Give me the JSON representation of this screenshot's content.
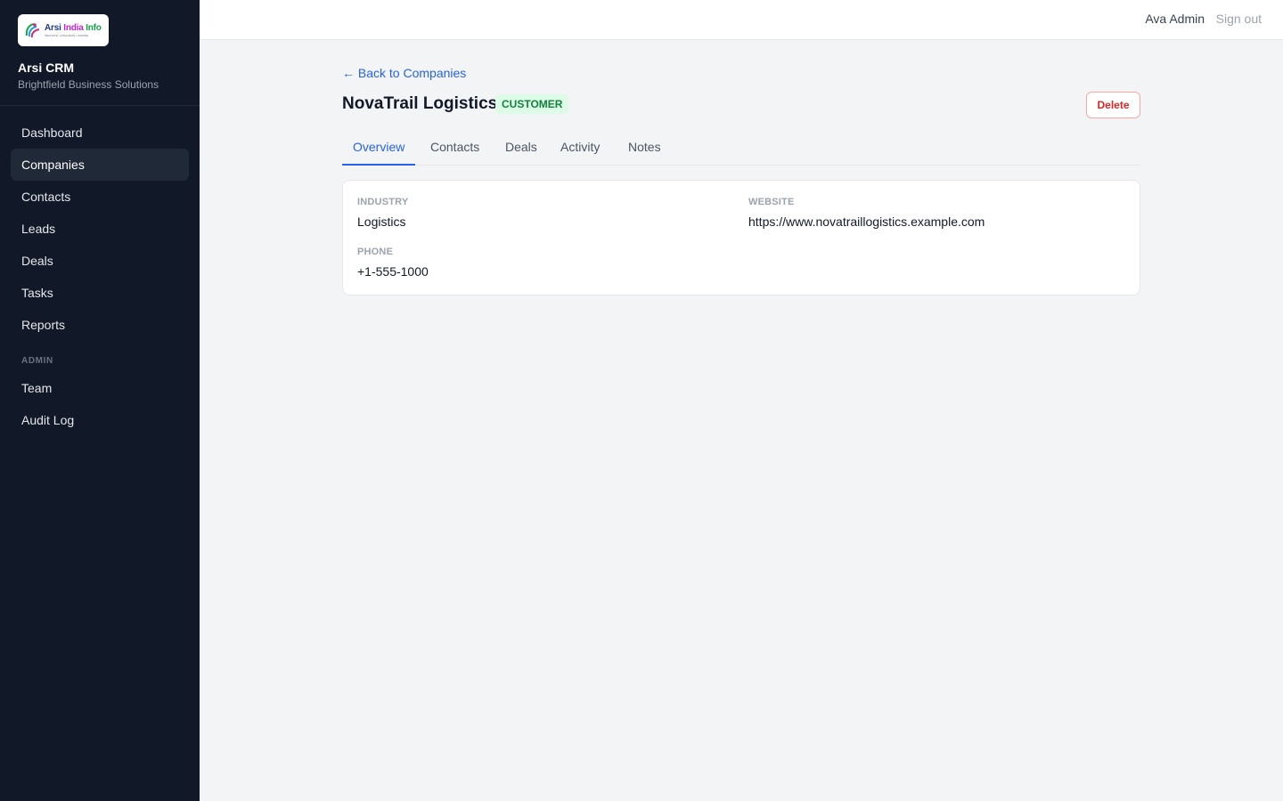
{
  "brand": {
    "logo_word_1": "Arsi",
    "logo_word_2": "India",
    "logo_word_3": "Info",
    "logo_tagline": "INNOVATE • INTEGRATE • INSPIRE",
    "app_name": "Arsi CRM",
    "org_name": "Brightfield Business Solutions"
  },
  "sidebar": {
    "items": [
      {
        "label": "Dashboard"
      },
      {
        "label": "Companies",
        "active": true
      },
      {
        "label": "Contacts"
      },
      {
        "label": "Leads"
      },
      {
        "label": "Deals"
      },
      {
        "label": "Tasks"
      },
      {
        "label": "Reports"
      }
    ],
    "admin_section_label": "ADMIN",
    "admin_items": [
      {
        "label": "Team"
      },
      {
        "label": "Audit Log"
      }
    ]
  },
  "topbar": {
    "user_name": "Ava Admin",
    "signout_label": "Sign out"
  },
  "page": {
    "back_link": "← Back to Companies",
    "title": "NovaTrail Logistics",
    "status_badge": "CUSTOMER",
    "delete_label": "Delete"
  },
  "tabs": [
    {
      "label": "Overview",
      "active": true
    },
    {
      "label": "Contacts"
    },
    {
      "label": "Deals"
    },
    {
      "label": "Activity"
    },
    {
      "label": "Notes"
    }
  ],
  "overview": {
    "industry_label": "INDUSTRY",
    "industry_value": "Logistics",
    "website_label": "WEBSITE",
    "website_value": "https://www.novatraillogistics.example.com",
    "phone_label": "PHONE",
    "phone_value": "+1-555-1000"
  },
  "colors": {
    "sidebar_bg": "#111827",
    "accent": "#2563eb",
    "badge_bg": "#dcfce7",
    "badge_text": "#15803d",
    "danger": "#dc2626"
  }
}
